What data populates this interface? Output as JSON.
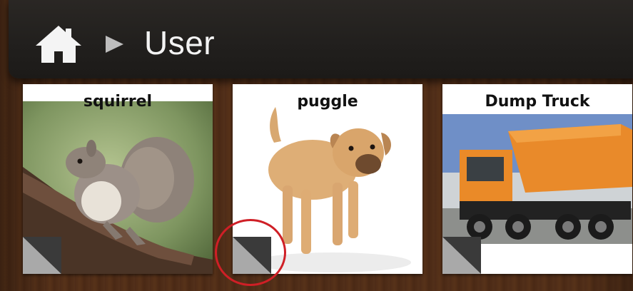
{
  "header": {
    "home_icon": "home-icon",
    "separator_icon": "triangle-right-icon",
    "title": "User"
  },
  "tiles": [
    {
      "label": "squirrel",
      "image": "squirrel-photo",
      "corner_icon": "folded-corner-icon"
    },
    {
      "label": "puggle",
      "image": "puggle-dog-photo",
      "corner_icon": "folded-corner-icon"
    },
    {
      "label": "Dump Truck",
      "image": "dump-truck-photo",
      "corner_icon": "folded-corner-icon"
    }
  ],
  "highlight": {
    "target": "tiles.1.corner",
    "color": "#cf1f26"
  }
}
